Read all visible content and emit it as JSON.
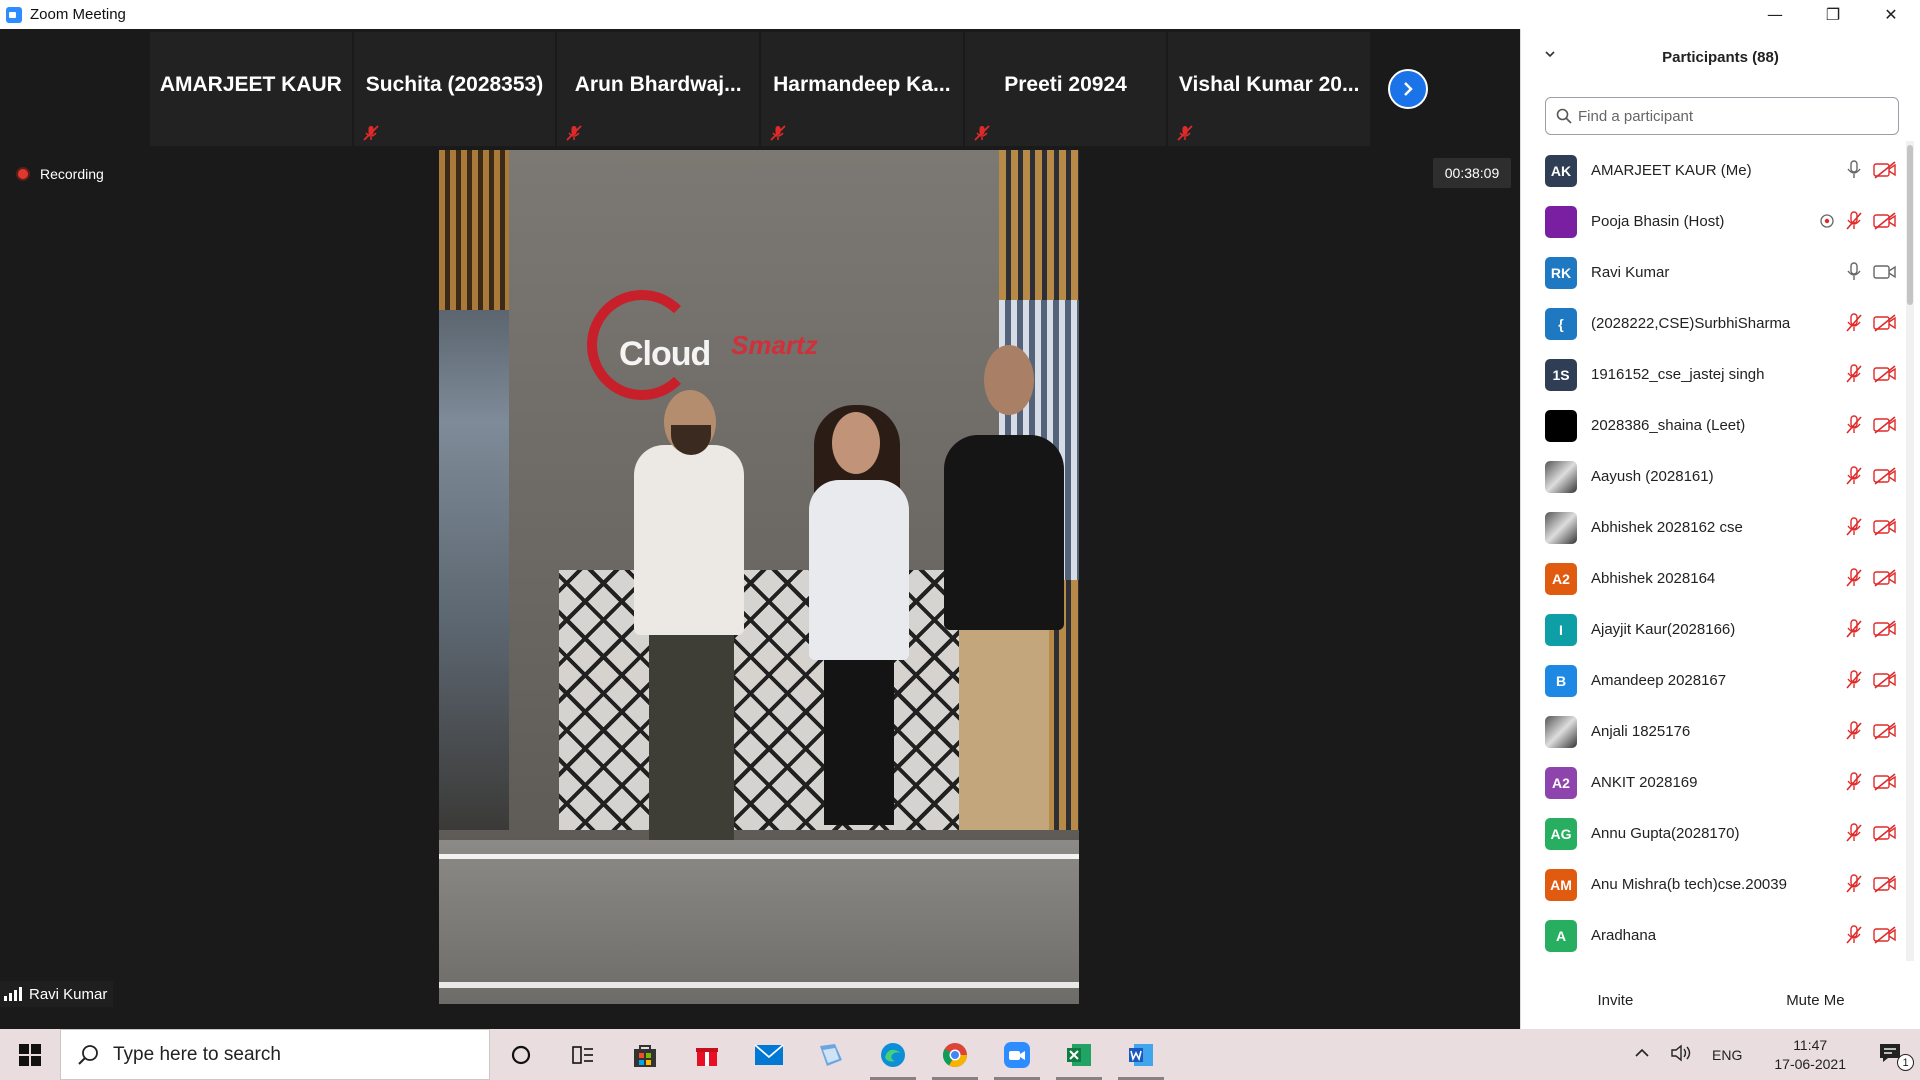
{
  "window": {
    "title": "Zoom Meeting",
    "controls": [
      "minimize",
      "restore",
      "close"
    ]
  },
  "gallery_strip": {
    "tiles": [
      {
        "name": "AMARJEET KAUR",
        "muted": false
      },
      {
        "name": "Suchita (2028353)",
        "muted": true
      },
      {
        "name": "Arun  Bhardwaj...",
        "muted": true
      },
      {
        "name": "Harmandeep  Ka...",
        "muted": true
      },
      {
        "name": "Preeti 20924",
        "muted": true
      },
      {
        "name": "Vishal  Kumar  20...",
        "muted": true
      }
    ],
    "next_icon": "chevron-right-icon"
  },
  "meeting": {
    "recording_label": "Recording",
    "timer": "00:38:09",
    "speaker_name": "Ravi Kumar",
    "video_sign_main": "Cloud",
    "video_sign_accent": "Smartz"
  },
  "panel": {
    "title": "Participants (88)",
    "search_placeholder": "Find a participant",
    "participants": [
      {
        "initials": "AK",
        "name": "AMARJEET KAUR (Me)",
        "color": "#2f3e54",
        "mic": "on",
        "video": "off",
        "extra": ""
      },
      {
        "initials": "",
        "name": "Pooja Bhasin (Host)",
        "color": "#7b1fa2",
        "mic": "muted",
        "video": "off",
        "extra": "screen-share-icon"
      },
      {
        "initials": "RK",
        "name": "Ravi Kumar",
        "color": "#1e78c2",
        "mic": "on",
        "video": "on",
        "extra": ""
      },
      {
        "initials": "{",
        "name": "(2028222,CSE)SurbhiSharma",
        "color": "#1e78c2",
        "mic": "muted",
        "video": "off",
        "extra": ""
      },
      {
        "initials": "1S",
        "name": "1916152_cse_jastej singh",
        "color": "#2f3e54",
        "mic": "muted",
        "video": "off",
        "extra": ""
      },
      {
        "initials": "",
        "name": "2028386_shaina (Leet)",
        "color": "#000000",
        "mic": "muted",
        "video": "off",
        "extra": ""
      },
      {
        "initials": "",
        "name": "Aayush (2028161)",
        "color": "photo",
        "mic": "muted",
        "video": "off",
        "extra": ""
      },
      {
        "initials": "",
        "name": "Abhishek 2028162 cse",
        "color": "photo",
        "mic": "muted",
        "video": "off",
        "extra": ""
      },
      {
        "initials": "A2",
        "name": "Abhishek 2028164",
        "color": "#e05a10",
        "mic": "muted",
        "video": "off",
        "extra": ""
      },
      {
        "initials": "I",
        "name": "Ajayjit Kaur(2028166)",
        "color": "#0e9ea6",
        "mic": "muted",
        "video": "off",
        "extra": ""
      },
      {
        "initials": "B",
        "name": "Amandeep 2028167",
        "color": "#1e88e5",
        "mic": "muted",
        "video": "off",
        "extra": ""
      },
      {
        "initials": "",
        "name": "Anjali 1825176",
        "color": "photo",
        "mic": "muted",
        "video": "off",
        "extra": ""
      },
      {
        "initials": "A2",
        "name": "ANKIT 2028169",
        "color": "#8e44ad",
        "mic": "muted",
        "video": "off",
        "extra": ""
      },
      {
        "initials": "AG",
        "name": "Annu Gupta(2028170)",
        "color": "#27ae60",
        "mic": "muted",
        "video": "off",
        "extra": ""
      },
      {
        "initials": "AM",
        "name": "Anu Mishra(b tech)cse.20039",
        "color": "#e05a10",
        "mic": "muted",
        "video": "off",
        "extra": ""
      },
      {
        "initials": "A",
        "name": "Aradhana",
        "color": "#27ae60",
        "mic": "muted",
        "video": "off",
        "extra": ""
      }
    ],
    "invite_label": "Invite",
    "mute_me_label": "Mute Me"
  },
  "taskbar": {
    "search_placeholder": "Type here to search",
    "apps": [
      "cortana-icon",
      "task-view-icon",
      "store-icon",
      "gift-icon",
      "mail-icon",
      "file-icon",
      "edge-icon",
      "chrome-icon",
      "zoom-icon",
      "excel-icon",
      "word-icon"
    ],
    "language": "ENG",
    "time": "11:47",
    "date": "17-06-2021",
    "notification_count": "1"
  }
}
